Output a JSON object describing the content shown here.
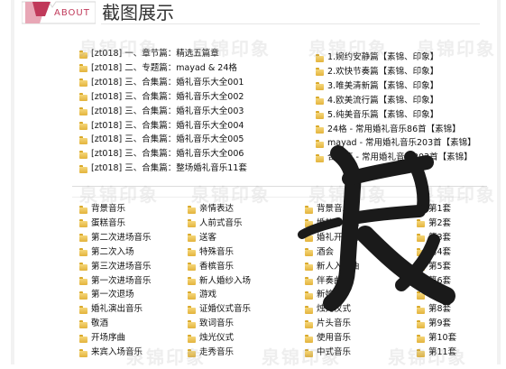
{
  "header": {
    "tag_label": "ABOUT",
    "title": "截图展示"
  },
  "watermark": "泉锦印象",
  "top_left_items": [
    "[zt018] 一、章节篇：精选五篇章",
    "[zt018] 二、专题篇：mayad & 24格",
    "[zt018] 三、合集篇：婚礼音乐大全001",
    "[zt018] 三、合集篇：婚礼音乐大全002",
    "[zt018] 三、合集篇：婚礼音乐大全003",
    "[zt018] 三、合集篇：婚礼音乐大全004",
    "[zt018] 三、合集篇：婚礼音乐大全005",
    "[zt018] 三、合集篇：婚礼音乐大全006",
    "[zt018] 三、合集篇：整场婚礼音乐11套"
  ],
  "top_right_items": [
    "1.婉约安静篇【素锦、印象】",
    "2.欢快节奏篇【素锦、印象】",
    "3.唯美清新篇【素锦、印象】",
    "4.欧美流行篇【素锦、印象】",
    "5.纯美音乐篇【素锦、印象】",
    "24格 - 常用婚礼音乐86首【素锦】",
    "mayad - 常用婚礼音乐203首【素锦】",
    "合集篇 - 常用婚礼音乐203首【素锦】"
  ],
  "bottom_col1": [
    "背景音乐",
    "蛋糕音乐",
    "第二次进场音乐",
    "第二次入场",
    "第三次进场音乐",
    "第一次进场音乐",
    "第一次退场",
    "婚礼演出音乐",
    "敬酒",
    "开场序曲",
    "来宾入场音乐"
  ],
  "bottom_col2": [
    "亲情表达",
    "人前式音乐",
    "送客",
    "特殊音乐",
    "香槟音乐",
    "新人婚纱入场",
    "游戏",
    "证婚仪式音乐",
    "致词音乐",
    "烛光仪式",
    "走秀音乐"
  ],
  "bottom_col3": [
    "背景音乐",
    "婚礼开场曲",
    "婚礼开场音效",
    "酒会",
    "新人入场曲",
    "伴奏曲",
    "新娘曲",
    "烛光仪式",
    "片头音乐",
    "使用音乐",
    "中式音乐"
  ],
  "bottom_col4": [
    "第1套",
    "第2套",
    "第3套",
    "第4套",
    "第5套",
    "第6套",
    "第7套",
    "第8套",
    "第9套",
    "第10套",
    "第11套"
  ],
  "colors": {
    "accent": "#c0395a",
    "folder": "#e3b33c"
  }
}
